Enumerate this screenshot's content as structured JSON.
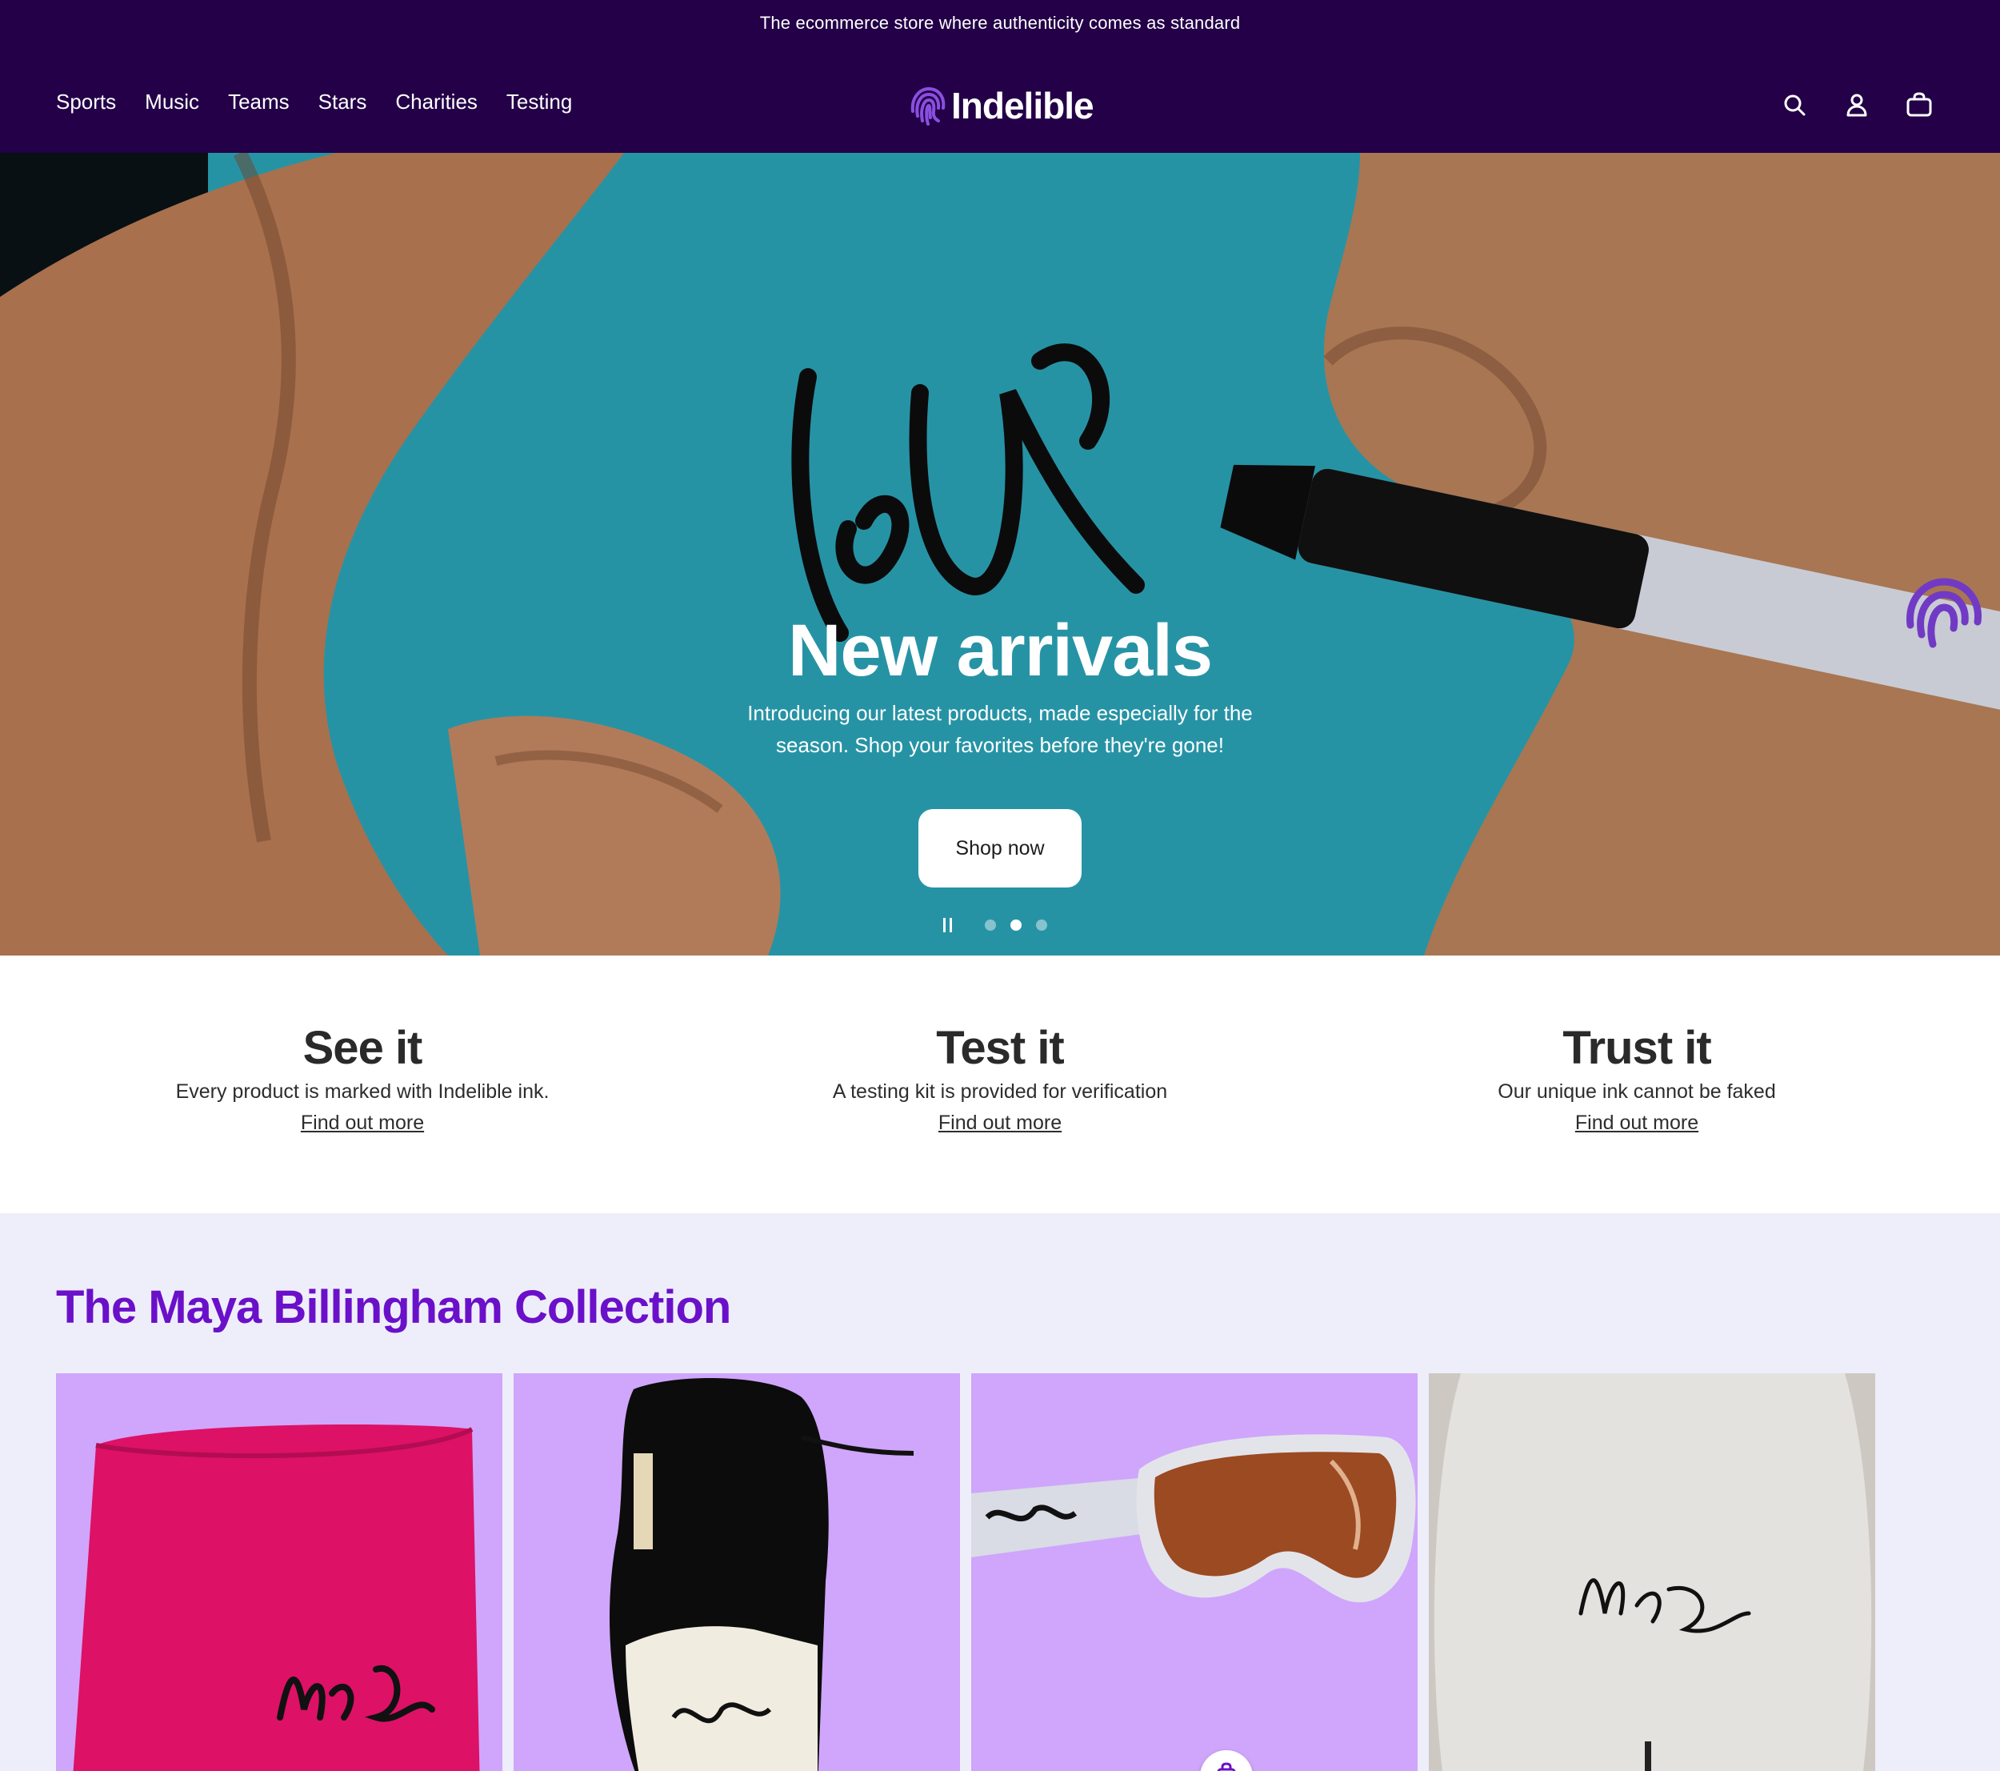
{
  "announcement": "The ecommerce store where authenticity comes as standard",
  "nav": {
    "items": [
      "Sports",
      "Music",
      "Teams",
      "Stars",
      "Charities",
      "Testing"
    ]
  },
  "brand": {
    "name": "Indelible",
    "icon": "fingerprint-icon"
  },
  "header_icons": [
    "search-icon",
    "account-icon",
    "cart-icon"
  ],
  "hero": {
    "title": "New arrivals",
    "text": "Introducing our latest products, made especially for the season. Shop your favorites before they're gone!",
    "button": "Shop now",
    "slides": 3,
    "active_slide": 2,
    "pause_icon": "pause-icon"
  },
  "features": [
    {
      "title": "See it",
      "text": "Every product is marked with Indelible ink.",
      "link": "Find out more"
    },
    {
      "title": "Test it",
      "text": "A testing kit is provided for verification",
      "link": "Find out more"
    },
    {
      "title": "Trust it",
      "text": "Our unique ink cannot be faked",
      "link": "Find out more"
    }
  ],
  "collection": {
    "title": "The Maya Billingham Collection",
    "products": [
      "signed-pink-beanie",
      "signed-ski-mitten",
      "signed-ski-goggles",
      "signed-snowboard"
    ]
  },
  "colors": {
    "header_bg": "#230047",
    "accent": "#6b10c9",
    "collection_bg": "#eeeefb",
    "card_bg": "#cfa6fb"
  }
}
